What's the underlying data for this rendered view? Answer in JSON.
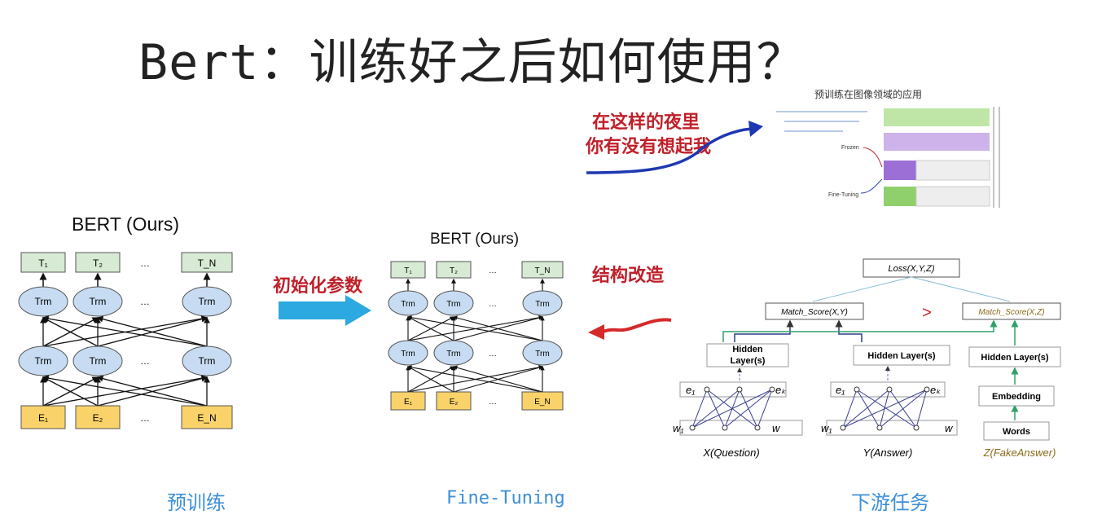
{
  "title": "Bert：训练好之后如何使用？",
  "pretrain_panel": {
    "title": "BERT (Ours)",
    "outputs": [
      "T₁",
      "T₂",
      "…",
      "T_N"
    ],
    "trm": "Trm",
    "ellipsis": "…",
    "inputs": [
      "E₁",
      "E₂",
      "…",
      "E_N"
    ],
    "caption": "预训练"
  },
  "arrow_init": {
    "label": "初始化参数",
    "color": "#2ba9e0"
  },
  "finetune_panel": {
    "title": "BERT (Ours)",
    "outputs": [
      "T₁",
      "T₂",
      "…",
      "T_N"
    ],
    "trm": "Trm",
    "inputs": [
      "E₁",
      "E₂",
      "…",
      "E_N"
    ],
    "caption": "Fine-Tuning"
  },
  "arrow_modify": {
    "label": "结构改造",
    "color": "#d42a2a"
  },
  "image_domain": {
    "title": "预训练在图像领域的应用",
    "frozen": "Frozen",
    "fine_tuning": "Fine-Tuning"
  },
  "note_red": {
    "line1": "在这样的夜里",
    "line2": "你有没有想起我"
  },
  "downstream": {
    "loss": "Loss(X,Y,Z)",
    "match1": "Match_Score(X,Y)",
    "match2": "Match_Score(X,Z)",
    "gt": ">",
    "hidden1": "Hidden Layer(s)",
    "hidden2": "Hidden Layer(s)",
    "hidden3": "Hidden Layer(s)",
    "embedding": "Embedding",
    "words": "Words",
    "e1": "e₁",
    "ek": "eₖ",
    "w1": "w₁",
    "w": "w",
    "x_label": "X(Question)",
    "y_label": "Y(Answer)",
    "z_label": "Z(FakeAnswer)",
    "caption": "下游任务"
  },
  "colors": {
    "t_box": "#d7ead3",
    "e_box": "#f9d26a",
    "trm": "#c7dcf2",
    "red": "#c0202a",
    "blue_caption": "#3d8fd8",
    "green_line": "#2fa06a"
  }
}
